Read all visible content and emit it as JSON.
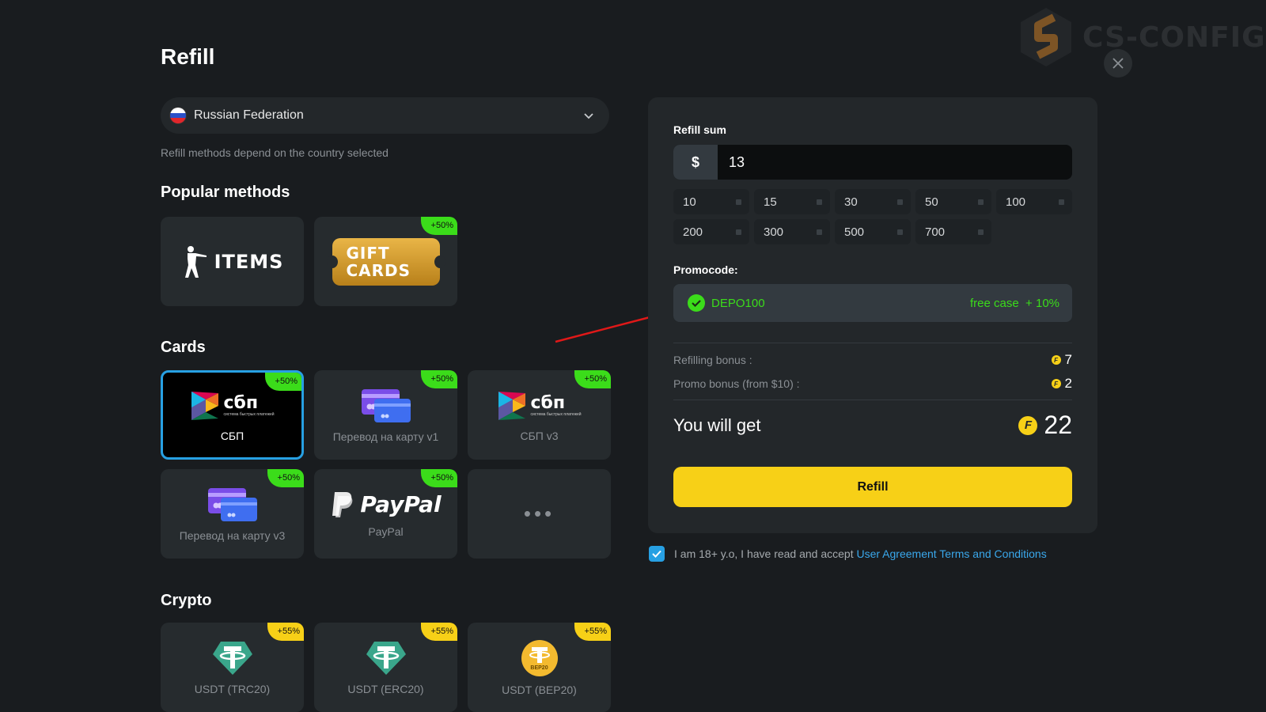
{
  "page": {
    "title": "Refill"
  },
  "brand": {
    "name": "CS-CONFIG"
  },
  "country": {
    "selected": "Russian Federation",
    "note": "Refill methods depend on the country selected"
  },
  "sections": {
    "popular": "Popular methods",
    "cards": "Cards",
    "crypto": "Crypto"
  },
  "popular": [
    {
      "logo_text": "ITEMS",
      "badge": ""
    },
    {
      "logo_line1": "GIFT",
      "logo_line2": "CARDS",
      "badge": "+50%"
    }
  ],
  "cards": [
    {
      "label": "СБП",
      "badge": "+50%",
      "logo_text": "сбп",
      "logo_sub": "система быстрых платежей",
      "selected": true
    },
    {
      "label": "Перевод на карту v1",
      "badge": "+50%"
    },
    {
      "label": "СБП v3",
      "badge": "+50%",
      "logo_text": "сбп",
      "logo_sub": "система быстрых платежей"
    },
    {
      "label": "Перевод на карту v3",
      "badge": "+50%"
    },
    {
      "label": "PayPal",
      "badge": "+50%",
      "logo_text": "PayPal"
    },
    {
      "label": "",
      "badge": "",
      "logo_text": "•••"
    }
  ],
  "crypto": [
    {
      "label": "USDT (TRC20)",
      "badge": "+55%"
    },
    {
      "label": "USDT (ERC20)",
      "badge": "+55%"
    },
    {
      "label": "USDT (BEP20)",
      "badge": "+55%",
      "icon_text": "BEP20"
    }
  ],
  "refill": {
    "sum_label": "Refill sum",
    "currency": "$",
    "amount": "13",
    "presets": [
      "10",
      "15",
      "30",
      "50",
      "100",
      "200",
      "300",
      "500",
      "700"
    ],
    "promo_label": "Promocode:",
    "promo_code": "DEPO100",
    "promo_bonus": "free case  + 10%",
    "refilling_bonus_label": "Refilling bonus :",
    "refilling_bonus_value": "7",
    "promo_bonus_label": "Promo bonus (from $10) :",
    "promo_bonus_value": "2",
    "coin_symbol": "F",
    "you_get_label": "You will get",
    "you_get_value": "22",
    "button": "Refill"
  },
  "agreement": {
    "text": "I am 18+ y.o, I have read and accept ",
    "link": "User Agreement Terms and Conditions",
    "checked": true
  },
  "colors": {
    "accent_yellow": "#f7d017",
    "accent_green": "#3bdc1a",
    "accent_blue": "#27a0e3",
    "background": "#191c1f",
    "panel": "#23272a"
  }
}
